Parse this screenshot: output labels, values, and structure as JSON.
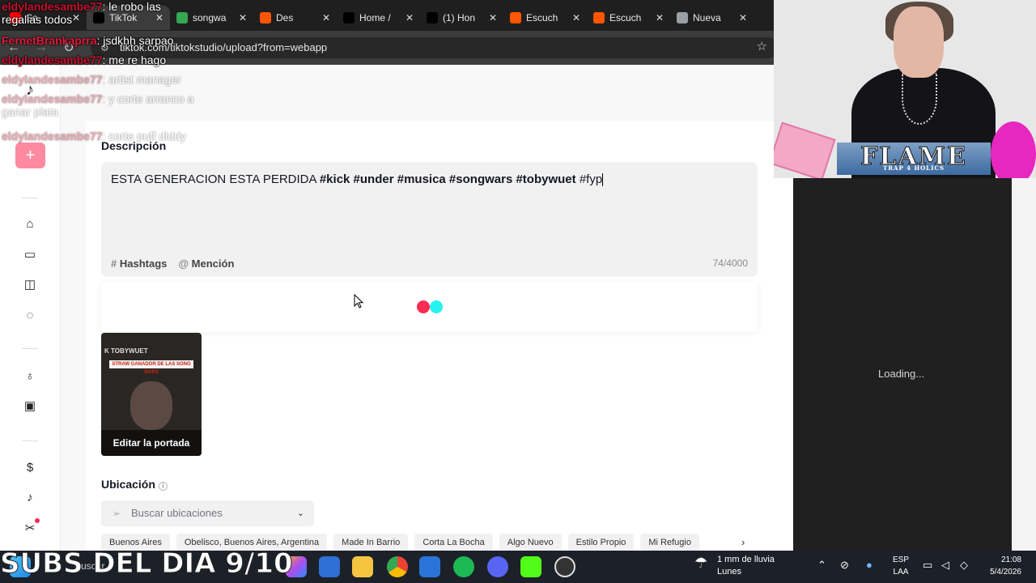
{
  "browser": {
    "tabs": [
      {
        "title": "Sa",
        "favicon": "youtube-icon",
        "color": "#ff0000"
      },
      {
        "title": "TikTok",
        "favicon": "tiktok-icon",
        "color": "#000000",
        "active": true
      },
      {
        "title": "songwa",
        "favicon": "drive-icon",
        "color": "#34a853"
      },
      {
        "title": "Des",
        "favicon": "soundcloud-icon",
        "color": "#ff5500"
      },
      {
        "title": "Home /",
        "favicon": "x-icon",
        "color": "#000000"
      },
      {
        "title": "(1) Hon",
        "favicon": "x-icon",
        "color": "#000000"
      },
      {
        "title": "Escuch",
        "favicon": "soundcloud-icon",
        "color": "#ff5500"
      },
      {
        "title": "Escuch",
        "favicon": "soundcloud-icon",
        "color": "#ff5500"
      },
      {
        "title": "Nueva",
        "favicon": "chrome-icon",
        "color": "#9aa0a6"
      }
    ],
    "url": "tiktok.com/tiktokstudio/upload?from=webapp"
  },
  "upload": {
    "description_label": "Descripción",
    "description_plain": "ESTA GENERACION ESTA PERDIDA ",
    "description_tags": "#kick  #under  #musica  #songwars  #tobywuet ",
    "description_last": "#fyp",
    "hashtags_label": "Hashtags",
    "mention_label": "Mención",
    "char_count": "74/4000",
    "loader_colors": [
      "#fe2c55",
      "#25f4ee"
    ],
    "cover": {
      "banner": "STRAW GANADOR DE LAS SONG WARS",
      "brand": "K TOBYWUET",
      "edit_label": "Editar la portada"
    },
    "location_label": "Ubicación",
    "location_placeholder": "Buscar ubicaciones",
    "location_chips": [
      "Buenos Aires",
      "Obelisco, Buenos Aires, Argentina",
      "Made In Barrio",
      "Corta La Bocha",
      "Algo Nuevo",
      "Estilo Propio",
      "Mi Refugio"
    ]
  },
  "right_panel": {
    "loading_text": "Loading..."
  },
  "webcam": {
    "overlay_logo": "FLAME",
    "overlay_sub": "TRAP 4 HOLICS"
  },
  "chat": {
    "lines": [
      {
        "user": "eldylandesambe77",
        "message": "le robo las regalias todos"
      },
      {
        "user": "FernetBrankaprra",
        "message": "jsdkhh sarpao"
      },
      {
        "user": "eldylandesambe77",
        "message": "me re hago"
      },
      {
        "user": "eldylandesambe77",
        "message": "artist manager"
      },
      {
        "user": "eldylandesambe77",
        "message": "y corte arranco a ganar plata"
      },
      {
        "user": "eldylandesambe77",
        "message": "corte puff diddy"
      }
    ],
    "user_color": "#c8102e",
    "alt_user_color": "#e0193c"
  },
  "overlay_text": "SUBS DEL DIA 9/10",
  "taskbar": {
    "search_placeholder": "Buscar",
    "weather": {
      "line1": "1 mm de lluvia",
      "line2": "Lunes"
    },
    "language": {
      "line1": "ESP",
      "line2": "LAA"
    },
    "clock": {
      "time": "21:08",
      "date": "5/4/2026"
    }
  }
}
